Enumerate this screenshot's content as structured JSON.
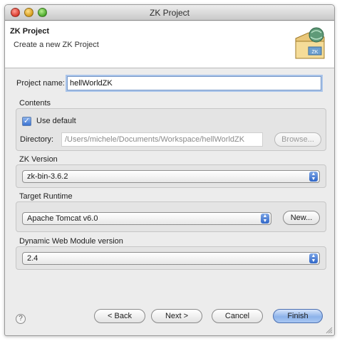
{
  "window": {
    "title": "ZK Project"
  },
  "banner": {
    "title": "ZK Project",
    "subtitle": "Create a new ZK Project",
    "icon_badge": "ZK",
    "icon": "zk-project-wizard-icon"
  },
  "project": {
    "label": "Project name:",
    "value": "hellWorldZK"
  },
  "contents": {
    "label": "Contents",
    "use_default_label": "Use default",
    "use_default_checked": true,
    "directory_label": "Directory:",
    "directory_value": "/Users/michele/Documents/Workspace/hellWorldZK",
    "browse_label": "Browse..."
  },
  "zk_version": {
    "label": "ZK Version",
    "selected": "zk-bin-3.6.2"
  },
  "target_runtime": {
    "label": "Target Runtime",
    "selected": "Apache Tomcat v6.0",
    "new_label": "New..."
  },
  "web_module": {
    "label": "Dynamic Web Module version",
    "selected": "2.4"
  },
  "footer": {
    "help_icon": "help-icon",
    "back_label": "< Back",
    "next_label": "Next >",
    "cancel_label": "Cancel",
    "finish_label": "Finish"
  },
  "colors": {
    "accent": "#3a73d2",
    "focus_ring": "#a9c4ea",
    "dialog_bg": "#ececec"
  }
}
